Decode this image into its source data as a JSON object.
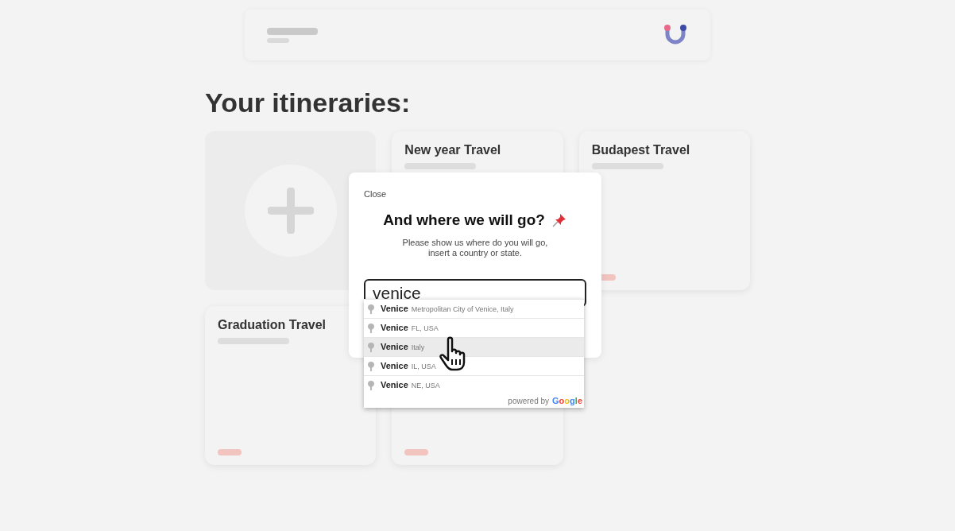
{
  "page": {
    "heading": "Your itineraries:"
  },
  "itineraries": [
    {
      "kind": "add"
    },
    {
      "kind": "trip",
      "title": "New year Travel",
      "subtitle": true,
      "footer": false
    },
    {
      "kind": "trip",
      "title": "Budapest Travel",
      "subtitle": true,
      "footer": true
    },
    {
      "kind": "trip",
      "title": "Graduation Travel",
      "subtitle": true,
      "footer": true
    },
    {
      "kind": "trip",
      "subtitle": false,
      "footer": true
    }
  ],
  "modal": {
    "close": "Close",
    "title": "And where we will go?",
    "subtitle_lines": [
      "Please show us where do you will go,",
      "insert a country or state."
    ],
    "search": {
      "value": "venice"
    },
    "suggestions": [
      {
        "main": "Venice",
        "secondary": "Metropolitan City of Venice, Italy",
        "selected": false
      },
      {
        "main": "Venice",
        "secondary": "FL, USA",
        "selected": false
      },
      {
        "main": "Venice",
        "secondary": "Italy",
        "selected": true
      },
      {
        "main": "Venice",
        "secondary": "IL, USA",
        "selected": false
      },
      {
        "main": "Venice",
        "secondary": "NE, USA",
        "selected": false
      }
    ],
    "attribution": {
      "prefix": "powered by",
      "brand": "Google"
    }
  }
}
